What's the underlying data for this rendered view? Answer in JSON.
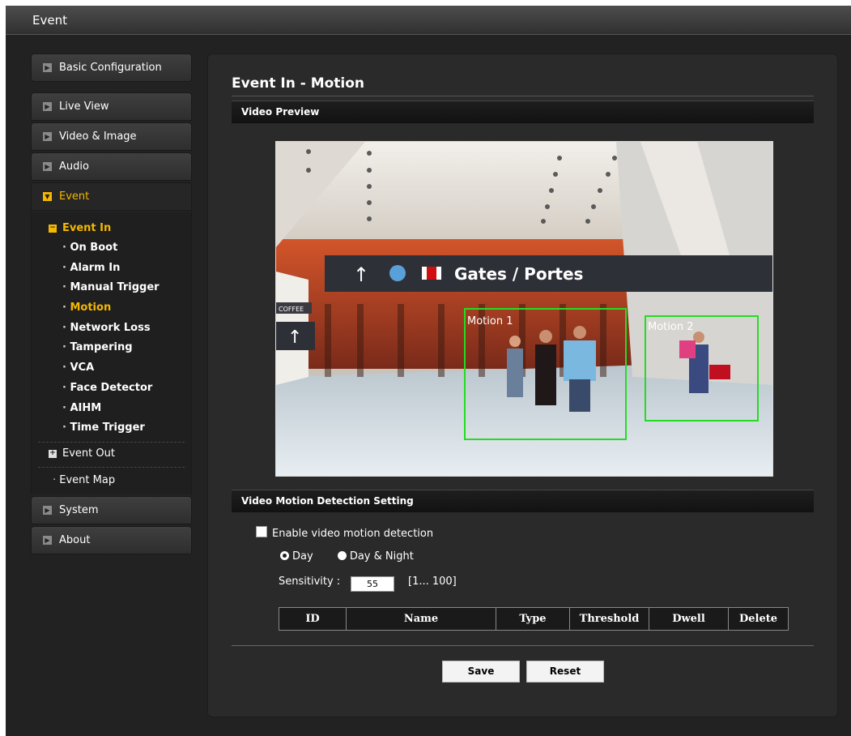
{
  "window": {
    "title": "Event"
  },
  "sidebar": {
    "top": {
      "label": "Basic Configuration"
    },
    "items": [
      {
        "label": "Live View"
      },
      {
        "label": "Video & Image"
      },
      {
        "label": "Audio"
      },
      {
        "label": "Event"
      }
    ],
    "event_sub": {
      "event_in": "Event In",
      "links": [
        "On Boot",
        "Alarm In",
        "Manual Trigger",
        "Motion",
        "Network Loss",
        "Tampering",
        "VCA",
        "Face Detector",
        "AIHM",
        "Time Trigger"
      ],
      "event_out": "Event Out",
      "event_map": "Event Map"
    },
    "bottom": [
      {
        "label": "System"
      },
      {
        "label": "About"
      }
    ]
  },
  "main": {
    "title": "Event In - Motion",
    "video_preview_header": "Video Preview",
    "video": {
      "sign_text": "Gates / Portes",
      "motion_labels": [
        "Motion 1",
        "Motion 2"
      ],
      "coffee_sign": "COFFEE"
    },
    "vmd_header": "Video Motion Detection Setting",
    "enable_label": "Enable video motion detection",
    "enable_checked": false,
    "radio_day": "Day",
    "radio_daynight": "Day & Night",
    "radio_selected": "Day",
    "sensitivity_label": "Sensitivity :",
    "sensitivity_value": "55",
    "sensitivity_range": "[1... 100]",
    "table_headers": [
      "ID",
      "Name",
      "Type",
      "Threshold",
      "Dwell",
      "Delete"
    ],
    "save_label": "Save",
    "reset_label": "Reset"
  },
  "colors": {
    "accent": "#f5b800",
    "motion_box": "#22dd22"
  }
}
